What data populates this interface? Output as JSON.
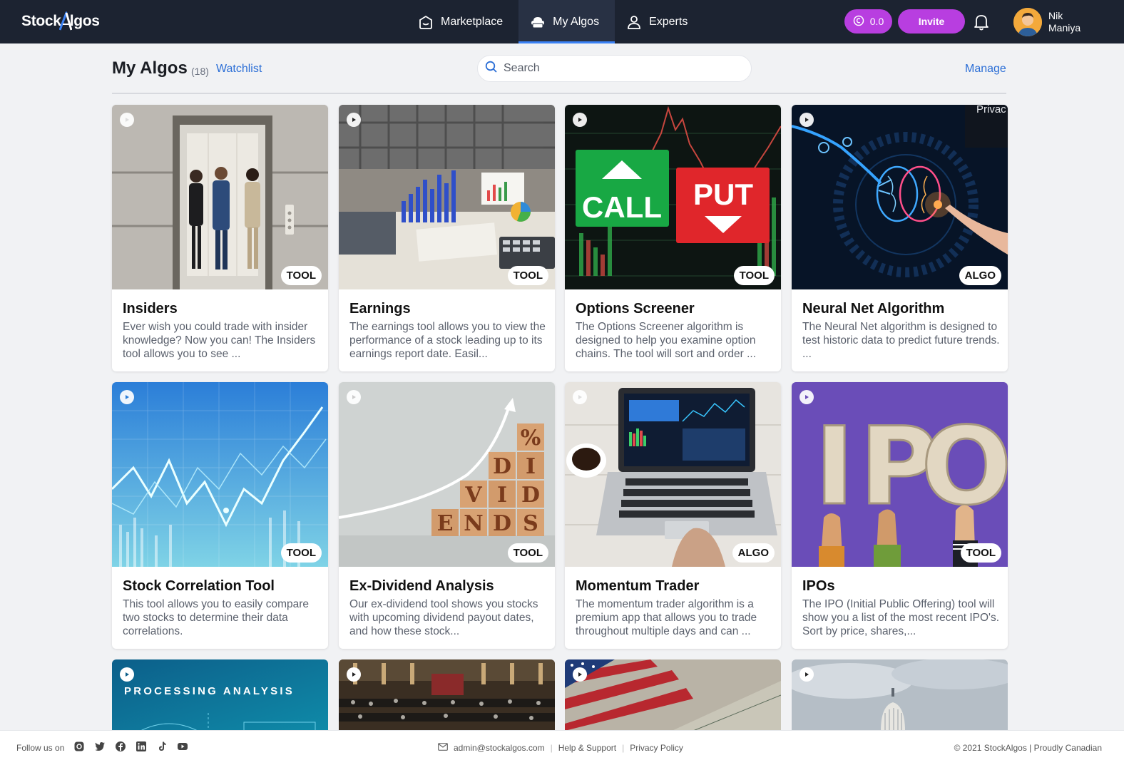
{
  "brand": {
    "name_part1": "Stock",
    "name_part2": "lgos"
  },
  "nav": {
    "tabs": [
      {
        "label": "Marketplace",
        "icon": "store-icon",
        "active": false
      },
      {
        "label": "My Algos",
        "icon": "cloud-box-icon",
        "active": true
      },
      {
        "label": "Experts",
        "icon": "user-icon",
        "active": false
      }
    ],
    "coins": "0.0",
    "invite_label": "Invite",
    "user": {
      "first": "Nik",
      "last": "Maniya"
    }
  },
  "header": {
    "title": "My Algos",
    "count": "(18)",
    "watchlist": "Watchlist",
    "search_placeholder": "Search",
    "manage": "Manage"
  },
  "cards": [
    {
      "title": "Insiders",
      "tag": "TOOL",
      "desc": "Ever wish you could trade with insider knowledge? Now you can! The Insiders tool allows you to see ..."
    },
    {
      "title": "Earnings",
      "tag": "TOOL",
      "desc": "The earnings tool allows you to view the performance of a stock leading up to its earnings report date. Easil..."
    },
    {
      "title": "Options Screener",
      "tag": "TOOL",
      "desc": "The Options Screener algorithm is designed to help you examine option chains. The tool will sort and order ..."
    },
    {
      "title": "Neural Net Algorithm",
      "tag": "ALGO",
      "desc": "The Neural Net algorithm is designed to test historic data to predict future trends. ..."
    },
    {
      "title": "Stock Correlation Tool",
      "tag": "TOOL",
      "desc": "This tool allows you to easily compare two stocks to determine their data correlations."
    },
    {
      "title": "Ex-Dividend Analysis",
      "tag": "TOOL",
      "desc": "Our ex-dividend tool shows you stocks with upcoming dividend payout dates, and how these stock..."
    },
    {
      "title": "Momentum Trader",
      "tag": "ALGO",
      "desc": "The momentum trader algorithm is a premium app that allows you to trade throughout multiple days and can ..."
    },
    {
      "title": "IPOs",
      "tag": "TOOL",
      "desc": "The IPO (Initial Public Offering) tool will show you a list of the most recent IPO's. Sort by price, shares,..."
    }
  ],
  "image_text": {
    "call": "CALL",
    "put": "PUT",
    "dividends": [
      "%",
      "D",
      "I",
      "V",
      "I",
      "D",
      "E",
      "N",
      "D",
      "S"
    ],
    "ipo": [
      "I",
      "P",
      "O"
    ],
    "processing": "PROCESSING ANALYSIS",
    "overlay_privacy": "Privac"
  },
  "footer": {
    "follow": "Follow us on",
    "email": "admin@stockalgos.com",
    "help": "Help & Support",
    "privacy": "Privacy Policy",
    "copyright": "© 2021 StockAlgos | Proudly Canadian"
  }
}
